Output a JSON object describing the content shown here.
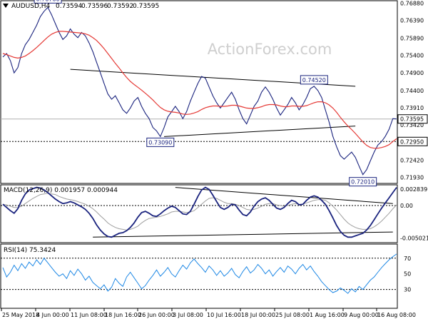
{
  "chart_data": [
    {
      "type": "line",
      "panel": "price",
      "title": "AUDUSD,H4",
      "ohlc_readout": [
        "0.73594",
        "0.73596",
        "0.73592",
        "0.73595"
      ],
      "watermark": "ActionForex.com",
      "ylim": [
        0.7176,
        0.7695
      ],
      "yticks": [
        "0.76880",
        "0.76390",
        "0.75890",
        "0.75400",
        "0.74900",
        "0.74400",
        "0.73910",
        "0.73420",
        "0.72920",
        "0.72420",
        "0.71930"
      ],
      "last_price_label": "0.73595",
      "support_level_label": "0.72950",
      "annotations": [
        "0.76760",
        "0.73090",
        "0.74520",
        "0.72010"
      ],
      "price_series": [
        0.7535,
        0.7545,
        0.7525,
        0.749,
        0.7505,
        0.7545,
        0.757,
        0.7585,
        0.7605,
        0.7625,
        0.765,
        0.7665,
        0.7676,
        0.7655,
        0.763,
        0.7605,
        0.7585,
        0.7595,
        0.7615,
        0.76,
        0.759,
        0.7605,
        0.7595,
        0.7575,
        0.755,
        0.752,
        0.749,
        0.746,
        0.743,
        0.7415,
        0.7425,
        0.7405,
        0.7385,
        0.7375,
        0.739,
        0.741,
        0.742,
        0.7395,
        0.7375,
        0.736,
        0.7335,
        0.7325,
        0.7309,
        0.7335,
        0.7365,
        0.738,
        0.7395,
        0.738,
        0.736,
        0.738,
        0.741,
        0.7435,
        0.746,
        0.748,
        0.7475,
        0.745,
        0.7425,
        0.7405,
        0.739,
        0.7405,
        0.742,
        0.7435,
        0.7415,
        0.7385,
        0.736,
        0.7345,
        0.737,
        0.7395,
        0.741,
        0.7435,
        0.745,
        0.7435,
        0.7415,
        0.739,
        0.737,
        0.7385,
        0.74,
        0.742,
        0.7405,
        0.7385,
        0.74,
        0.742,
        0.7445,
        0.7452,
        0.744,
        0.742,
        0.7385,
        0.735,
        0.731,
        0.728,
        0.7255,
        0.7245,
        0.7255,
        0.7265,
        0.725,
        0.7225,
        0.7201,
        0.7215,
        0.724,
        0.7265,
        0.7285,
        0.7295,
        0.731,
        0.733,
        0.736,
        0.7359
      ],
      "ma_series": [
        0.7545,
        0.7542,
        0.7538,
        0.7534,
        0.7532,
        0.7534,
        0.7538,
        0.7545,
        0.7553,
        0.7562,
        0.7572,
        0.7582,
        0.7592,
        0.76,
        0.7605,
        0.7608,
        0.7608,
        0.7607,
        0.7606,
        0.7605,
        0.7604,
        0.7603,
        0.7601,
        0.7597,
        0.759,
        0.7582,
        0.7571,
        0.7559,
        0.7545,
        0.7531,
        0.7517,
        0.7504,
        0.749,
        0.7477,
        0.7466,
        0.7457,
        0.7449,
        0.7441,
        0.7432,
        0.7423,
        0.7413,
        0.7402,
        0.7392,
        0.7385,
        0.7381,
        0.7379,
        0.7378,
        0.7376,
        0.7373,
        0.7372,
        0.7373,
        0.7376,
        0.738,
        0.7386,
        0.7391,
        0.7394,
        0.7396,
        0.7396,
        0.7395,
        0.7395,
        0.7396,
        0.7398,
        0.7398,
        0.7396,
        0.7393,
        0.739,
        0.7389,
        0.7389,
        0.7391,
        0.7394,
        0.7398,
        0.74,
        0.74,
        0.7399,
        0.7396,
        0.7394,
        0.7394,
        0.7396,
        0.7396,
        0.7395,
        0.7395,
        0.7397,
        0.7401,
        0.7405,
        0.7408,
        0.7408,
        0.7405,
        0.7399,
        0.739,
        0.7378,
        0.7364,
        0.7351,
        0.7339,
        0.7329,
        0.7318,
        0.7306,
        0.7294,
        0.7284,
        0.7278,
        0.7276,
        0.7276,
        0.7278,
        0.7281,
        0.7286,
        0.7295,
        0.7303
      ],
      "trendlines": [
        {
          "from": [
            18,
            0.75
          ],
          "to": [
            94,
            0.7452
          ]
        },
        {
          "from": [
            43,
            0.7309
          ],
          "to": [
            94,
            0.7339
          ]
        }
      ],
      "support_level": 0.7295
    },
    {
      "type": "line",
      "panel": "macd",
      "title": "MACD(12,26,9) 0.001957 0.000944",
      "ylim": [
        -0.00575,
        0.0032
      ],
      "yticks": [
        "0.002839",
        "0.00",
        "-0.005021"
      ],
      "macd_series": [
        0.0002,
        -0.0003,
        -0.0008,
        -0.0012,
        -0.0005,
        0.0008,
        0.0018,
        0.0024,
        0.0026,
        0.0028,
        0.0027,
        0.0024,
        0.002,
        0.0015,
        0.001,
        0.0006,
        0.0003,
        0.0004,
        0.0006,
        0.0004,
        0.0001,
        -0.0002,
        -0.0006,
        -0.0012,
        -0.002,
        -0.003,
        -0.0038,
        -0.0044,
        -0.0048,
        -0.0049,
        -0.0046,
        -0.0043,
        -0.0042,
        -0.0039,
        -0.0034,
        -0.0027,
        -0.0018,
        -0.0011,
        -0.0009,
        -0.0012,
        -0.0016,
        -0.0017,
        -0.0013,
        -0.0008,
        -0.0004,
        -0.0001,
        -0.0003,
        -0.0008,
        -0.0013,
        -0.0014,
        -0.0009,
        0.0002,
        0.0014,
        0.0024,
        0.0028,
        0.0025,
        0.0016,
        0.0006,
        -0.0003,
        -0.0006,
        -0.0003,
        0.0002,
        0.0001,
        -0.0007,
        -0.0014,
        -0.0016,
        -0.001,
        -0.0001,
        0.0006,
        0.001,
        0.0012,
        0.0008,
        0.0002,
        -0.0004,
        -0.0006,
        -0.0003,
        0.0003,
        0.0008,
        0.0006,
        0.0001,
        0.0002,
        0.0008,
        0.0013,
        0.0015,
        0.0013,
        0.0008,
        0.0002,
        -0.0008,
        -0.0019,
        -0.0031,
        -0.004,
        -0.0046,
        -0.0049,
        -0.0049,
        -0.0047,
        -0.0045,
        -0.0043,
        -0.0038,
        -0.0031,
        -0.0022,
        -0.0013,
        -0.0004,
        0.0004,
        0.0012,
        0.002,
        0.0028
      ],
      "signal_series": [
        0.0002,
        0.0001,
        -0.0001,
        -0.0003,
        -0.0003,
        -0.0001,
        0.0003,
        0.0007,
        0.0011,
        0.0014,
        0.0017,
        0.0018,
        0.0019,
        0.0018,
        0.0017,
        0.0014,
        0.0012,
        0.001,
        0.0009,
        0.0008,
        0.0006,
        0.0004,
        0.0002,
        -0.0001,
        -0.0005,
        -0.001,
        -0.0016,
        -0.0021,
        -0.0027,
        -0.0031,
        -0.0034,
        -0.0036,
        -0.0037,
        -0.0038,
        -0.0037,
        -0.0035,
        -0.0032,
        -0.0027,
        -0.0023,
        -0.002,
        -0.0019,
        -0.0018,
        -0.0017,
        -0.0015,
        -0.0013,
        -0.001,
        -0.0009,
        -0.0009,
        -0.001,
        -0.0011,
        -0.001,
        -0.0008,
        -0.0003,
        0.0002,
        0.0007,
        0.0011,
        0.0012,
        0.0011,
        0.0008,
        0.0005,
        0.0003,
        0.0003,
        0.0002,
        0.0,
        -0.0003,
        -0.0006,
        -0.0007,
        -0.0006,
        -0.0004,
        -0.0001,
        0.0002,
        0.0003,
        0.0003,
        0.0001,
        0.0,
        -0.0001,
        0.0,
        0.0002,
        0.0003,
        0.0002,
        0.0002,
        0.0004,
        0.0006,
        0.0008,
        0.0009,
        0.0009,
        0.0008,
        0.0004,
        -0.0001,
        -0.0007,
        -0.0014,
        -0.0021,
        -0.0027,
        -0.0031,
        -0.0034,
        -0.0036,
        -0.0037,
        -0.0037,
        -0.0036,
        -0.0033,
        -0.0029,
        -0.0024,
        -0.0018,
        -0.0012,
        -0.0005,
        0.0001
      ],
      "trendlines": [
        {
          "from": [
            46,
            0.0028
          ],
          "to": [
            104,
            0.0003
          ]
        },
        {
          "from": [
            24,
            -0.0049
          ],
          "to": [
            104,
            -0.0041
          ]
        }
      ]
    },
    {
      "type": "line",
      "panel": "rsi",
      "title": "RSI(14) 75.3424",
      "ylim": [
        6,
        88
      ],
      "yticks": [
        "70",
        "50",
        "30"
      ],
      "levels": [
        70,
        30
      ],
      "rsi_series": [
        58,
        46,
        52,
        61,
        54,
        63,
        57,
        65,
        60,
        68,
        62,
        70,
        64,
        58,
        52,
        47,
        50,
        44,
        54,
        48,
        56,
        50,
        42,
        47,
        39,
        35,
        31,
        36,
        28,
        33,
        44,
        38,
        34,
        46,
        52,
        45,
        38,
        31,
        35,
        42,
        48,
        55,
        47,
        52,
        58,
        50,
        46,
        54,
        61,
        56,
        64,
        69,
        63,
        58,
        52,
        60,
        55,
        48,
        54,
        47,
        51,
        57,
        49,
        45,
        53,
        59,
        51,
        55,
        62,
        57,
        50,
        55,
        47,
        53,
        58,
        52,
        60,
        56,
        50,
        57,
        62,
        55,
        60,
        53,
        47,
        40,
        35,
        30,
        26,
        28,
        32,
        29,
        25,
        31,
        27,
        34,
        30,
        36,
        42,
        46,
        52,
        58,
        63,
        68,
        72,
        75.3
      ]
    }
  ],
  "xaxis": {
    "tick_labels": [
      "25 May 2018",
      "4 Jun 00:00",
      "11 Jun 08:00",
      "18 Jun 16:00",
      "26 Jun 00:00",
      "3 Jul 08:00",
      "10 Jul 16:00",
      "18 Jul 00:00",
      "25 Jul 08:00",
      "1 Aug 16:00",
      "9 Aug 00:00",
      "16 Aug 08:00"
    ]
  }
}
